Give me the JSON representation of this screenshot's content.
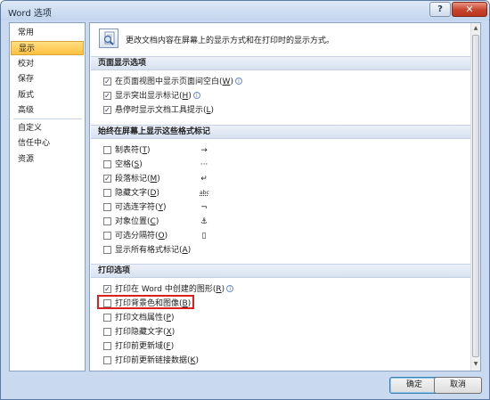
{
  "window": {
    "title": "Word 选项",
    "help_glyph": "?",
    "close_glyph": "✕"
  },
  "nav": {
    "items": [
      {
        "label": "常用",
        "selected": false
      },
      {
        "label": "显示",
        "selected": true
      },
      {
        "label": "校对",
        "selected": false
      },
      {
        "label": "保存",
        "selected": false
      },
      {
        "label": "版式",
        "selected": false
      },
      {
        "label": "高级",
        "selected": false
      },
      {
        "label": "自定义",
        "selected": false
      },
      {
        "label": "信任中心",
        "selected": false
      },
      {
        "label": "资源",
        "selected": false
      }
    ]
  },
  "header": {
    "icon": "magnifier-document-icon",
    "text": "更改文档内容在屏幕上的显示方式和在打印时的显示方式。"
  },
  "sections": {
    "page_display": {
      "title": "页面显示选项",
      "options": [
        {
          "label": "在页面视图中显示页面间空白",
          "accel": "W",
          "checked": true,
          "info": true
        },
        {
          "label": "显示突出显示标记",
          "accel": "H",
          "checked": true,
          "info": true
        },
        {
          "label": "悬停时显示文档工具提示",
          "accel": "L",
          "checked": true,
          "info": false
        }
      ]
    },
    "formatting_marks": {
      "title": "始终在屏幕上显示这些格式标记",
      "options": [
        {
          "label": "制表符",
          "accel": "T",
          "checked": false,
          "symbol": "→"
        },
        {
          "label": "空格",
          "accel": "S",
          "checked": false,
          "symbol": "···"
        },
        {
          "label": "段落标记",
          "accel": "M",
          "checked": true,
          "symbol": "↵"
        },
        {
          "label": "隐藏文字",
          "accel": "D",
          "checked": false,
          "symbol": "abc"
        },
        {
          "label": "可选连字符",
          "accel": "Y",
          "checked": false,
          "symbol": "¬"
        },
        {
          "label": "对象位置",
          "accel": "C",
          "checked": false,
          "symbol": "⚓"
        },
        {
          "label": "可选分隔符",
          "accel": "O",
          "checked": false,
          "symbol": "▯"
        },
        {
          "label": "显示所有格式标记",
          "accel": "A",
          "checked": false,
          "symbol": ""
        }
      ]
    },
    "print": {
      "title": "打印选项",
      "options": [
        {
          "label": "打印在 Word 中创建的图形",
          "accel": "R",
          "checked": true,
          "info": true
        },
        {
          "label": "打印背景色和图像",
          "accel": "B",
          "checked": false,
          "info": false,
          "highlighted": true
        },
        {
          "label": "打印文档属性",
          "accel": "P",
          "checked": false,
          "info": false
        },
        {
          "label": "打印隐藏文字",
          "accel": "X",
          "checked": false,
          "info": false
        },
        {
          "label": "打印前更新域",
          "accel": "F",
          "checked": false,
          "info": false
        },
        {
          "label": "打印前更新链接数据",
          "accel": "K",
          "checked": false,
          "info": false
        }
      ]
    }
  },
  "buttons": {
    "ok": "确定",
    "cancel": "取消"
  },
  "colors": {
    "selected_nav": "#ffc140",
    "highlight_box": "#dc1f1f",
    "section_band": "#d7e2f0"
  }
}
